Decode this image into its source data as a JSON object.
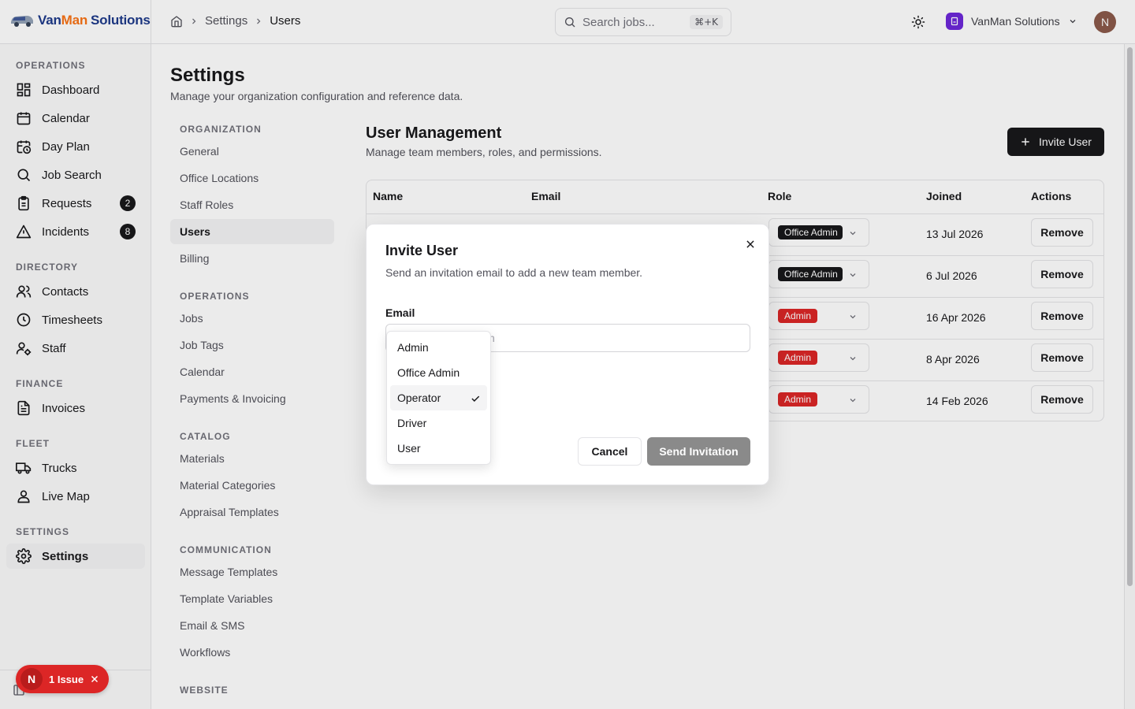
{
  "brand": {
    "part1": "Van",
    "part2": "Man",
    "part3": " Solutions"
  },
  "breadcrumb": {
    "settings": "Settings",
    "current": "Users"
  },
  "search": {
    "placeholder": "Search jobs...",
    "shortcut": "⌘+K"
  },
  "org": {
    "name": "VanMan Solutions"
  },
  "user": {
    "initial": "N"
  },
  "sidebar": {
    "sections": [
      {
        "title": "OPERATIONS",
        "items": [
          {
            "label": "Dashboard",
            "icon": "dashboard-icon"
          },
          {
            "label": "Calendar",
            "icon": "calendar-icon"
          },
          {
            "label": "Day Plan",
            "icon": "day-plan-icon"
          },
          {
            "label": "Job Search",
            "icon": "search-icon"
          },
          {
            "label": "Requests",
            "icon": "clipboard-icon",
            "badge": "2"
          },
          {
            "label": "Incidents",
            "icon": "warning-icon",
            "badge": "8"
          }
        ]
      },
      {
        "title": "DIRECTORY",
        "items": [
          {
            "label": "Contacts",
            "icon": "users-icon"
          },
          {
            "label": "Timesheets",
            "icon": "clock-icon"
          },
          {
            "label": "Staff",
            "icon": "user-cog-icon"
          }
        ]
      },
      {
        "title": "FINANCE",
        "items": [
          {
            "label": "Invoices",
            "icon": "invoice-icon"
          }
        ]
      },
      {
        "title": "FLEET",
        "items": [
          {
            "label": "Trucks",
            "icon": "truck-icon"
          },
          {
            "label": "Live Map",
            "icon": "map-pin-icon"
          }
        ]
      },
      {
        "title": "SETTINGS",
        "items": [
          {
            "label": "Settings",
            "icon": "gear-icon",
            "active": true
          }
        ]
      }
    ]
  },
  "page": {
    "title": "Settings",
    "subtitle": "Manage your organization configuration and reference data."
  },
  "settings_nav": {
    "groups": [
      {
        "title": "ORGANIZATION",
        "items": [
          "General",
          "Office Locations",
          "Staff Roles",
          "Users",
          "Billing"
        ]
      },
      {
        "title": "OPERATIONS",
        "items": [
          "Jobs",
          "Job Tags",
          "Calendar",
          "Payments & Invoicing"
        ]
      },
      {
        "title": "CATALOG",
        "items": [
          "Materials",
          "Material Categories",
          "Appraisal Templates"
        ]
      },
      {
        "title": "COMMUNICATION",
        "items": [
          "Message Templates",
          "Template Variables",
          "Email & SMS",
          "Workflows"
        ]
      },
      {
        "title": "WEBSITE",
        "items": []
      }
    ],
    "active": "Users"
  },
  "user_management": {
    "title": "User Management",
    "subtitle": "Manage team members, roles, and permissions.",
    "invite_label": "Invite User",
    "columns": [
      "Name",
      "Email",
      "Role",
      "Joined",
      "Actions"
    ],
    "rows": [
      {
        "role": "Office Admin",
        "joined": "13 Jul 2026",
        "action": "Remove"
      },
      {
        "role": "Office Admin",
        "joined": "6 Jul 2026",
        "action": "Remove"
      },
      {
        "role": "Admin",
        "joined": "16 Apr 2026",
        "action": "Remove"
      },
      {
        "role": "Admin",
        "joined": "8 Apr 2026",
        "action": "Remove"
      },
      {
        "role": "Admin",
        "joined": "14 Feb 2026",
        "action": "Remove"
      }
    ]
  },
  "modal": {
    "title": "Invite User",
    "description": "Send an invitation email to add a new team member.",
    "email_label": "Email",
    "email_placeholder_visible": "n",
    "cancel": "Cancel",
    "send": "Send Invitation"
  },
  "role_dropdown": {
    "options": [
      "Admin",
      "Office Admin",
      "Operator",
      "Driver",
      "User"
    ],
    "selected": "Operator"
  },
  "issue_badge": {
    "initial": "N",
    "label": "1 Issue"
  },
  "colors": {
    "accent": "#18181b",
    "danger": "#dc2626",
    "brand_blue": "#1e3a8a",
    "brand_orange": "#f97316",
    "org_purple": "#6d28d9"
  }
}
